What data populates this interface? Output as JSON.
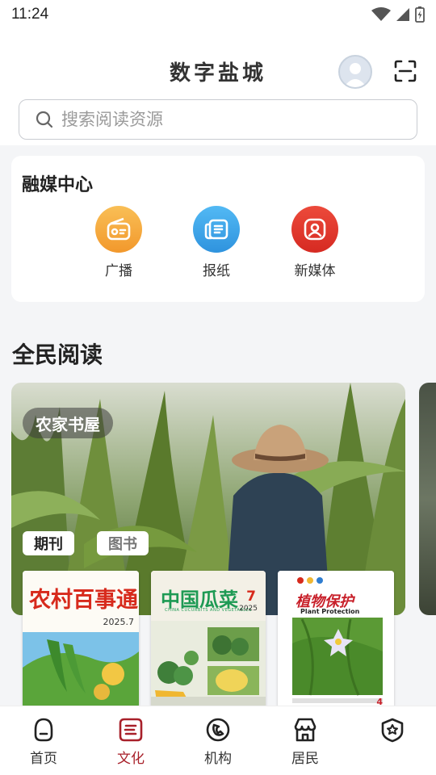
{
  "status": {
    "time": "11:24"
  },
  "header": {
    "title": "数字盐城",
    "search_placeholder": "搜索阅读资源"
  },
  "media_center": {
    "title": "融媒中心",
    "items": [
      {
        "label": "广播",
        "color": "#f5a93b",
        "icon": "radio-icon"
      },
      {
        "label": "报纸",
        "color": "#3ba6ea",
        "icon": "newspaper-icon"
      },
      {
        "label": "新媒体",
        "color": "#e0352b",
        "icon": "new-media-icon"
      }
    ]
  },
  "reading": {
    "title": "全民阅读",
    "banner_tag": "农家书屋",
    "tabs": [
      "期刊",
      "图书"
    ],
    "books": [
      {
        "title": "农村百事通",
        "issue": "2025.7"
      },
      {
        "title": "中国瓜菜",
        "subtitle": "CHINA CUCURBITS AND VEGETABLES",
        "issue_no": "7",
        "year": "2025"
      },
      {
        "title": "植物保护",
        "subtitle": "Plant Protection",
        "issue_no": "4"
      }
    ]
  },
  "bottom_nav": [
    {
      "label": "首页",
      "icon": "home-icon",
      "active": false
    },
    {
      "label": "文化",
      "icon": "culture-icon",
      "active": true
    },
    {
      "label": "机构",
      "icon": "institution-icon",
      "active": false
    },
    {
      "label": "居民",
      "icon": "resident-icon",
      "active": false
    },
    {
      "label": "",
      "icon": "service-icon",
      "active": false
    }
  ],
  "colors": {
    "accent": "#a8202a"
  }
}
